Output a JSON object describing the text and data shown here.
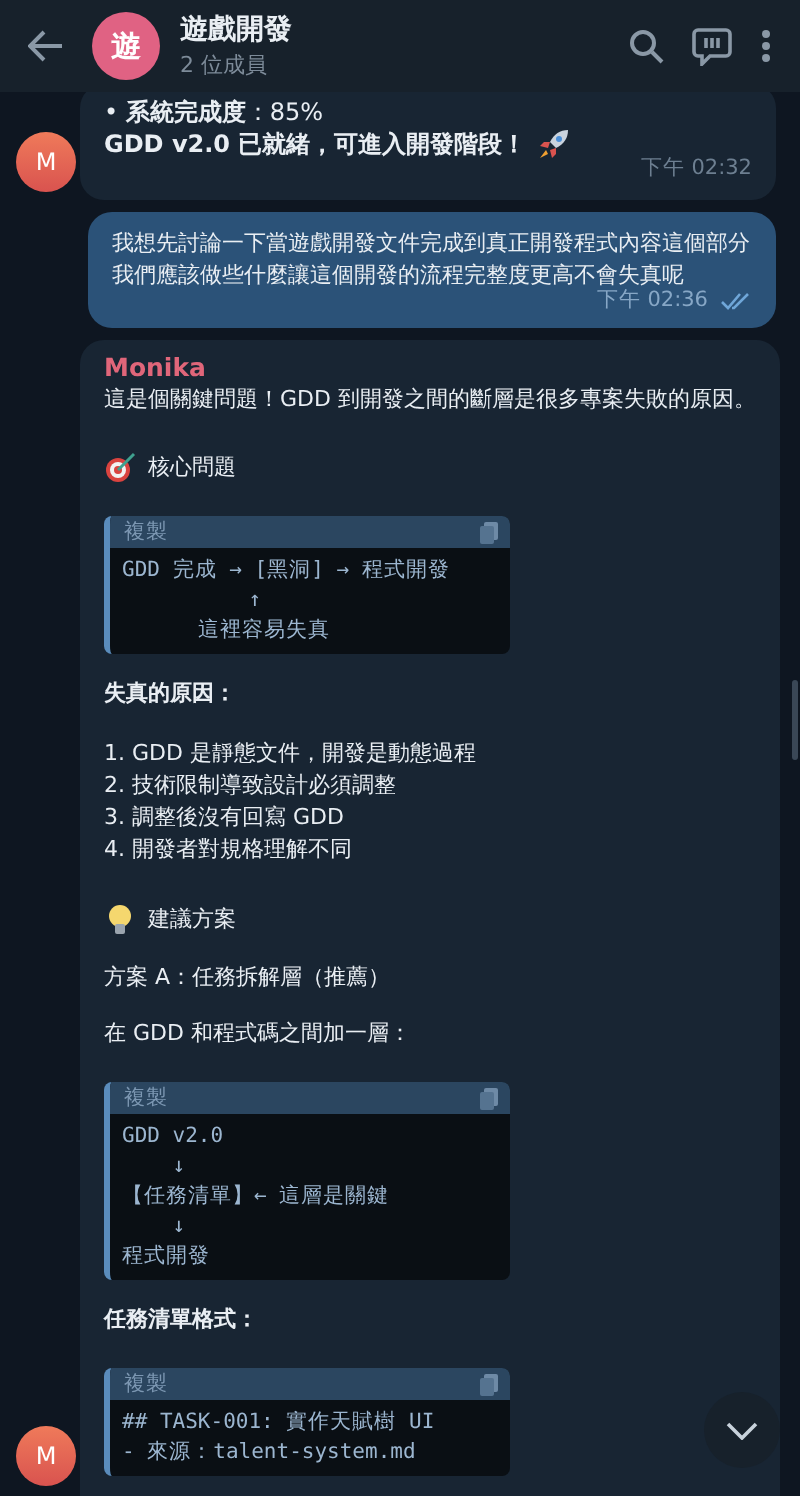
{
  "header": {
    "avatar_letter": "遊",
    "title": "遊戲開發",
    "subtitle": "2 位成員"
  },
  "messages": [
    {
      "kind": "incoming",
      "avatar": "M",
      "time": "下午 02:32",
      "blocks": [
        {
          "kind": "text",
          "text": "• **系統完成度**：85%"
        },
        {
          "kind": "rocket",
          "text": "GDD v2.0 已就緒，可進入開發階段！"
        }
      ]
    },
    {
      "kind": "outgoing",
      "time": "下午 02:36",
      "read": true,
      "blocks": [
        {
          "kind": "text",
          "text": "我想先討論一下當遊戲開發文件完成到真正開發程式內容這個部分"
        },
        {
          "kind": "text",
          "text": "我們應該做些什麼讓這個開發的流程完整度更高不會失真呢"
        }
      ]
    },
    {
      "kind": "incoming",
      "avatar": "M",
      "sender": "Monika",
      "blocks": [
        {
          "kind": "text",
          "text": "這是個關鍵問題！GDD 到開發之間的斷層是很多專案失敗的原因。"
        },
        {
          "kind": "target",
          "text": "核心問題"
        },
        {
          "kind": "code",
          "copy_label": "複製",
          "lines": [
            "GDD 完成 → [黑洞] → 程式開發",
            "          ↑",
            "      這裡容易失真"
          ]
        },
        {
          "kind": "bold",
          "text": "失真的原因："
        },
        {
          "kind": "list",
          "items": [
            "1. GDD 是靜態文件，開發是動態過程",
            "2. 技術限制導致設計必須調整",
            "3. 調整後沒有回寫 GDD",
            "4. 開發者對規格理解不同"
          ]
        },
        {
          "kind": "bulb",
          "text": "建議方案"
        },
        {
          "kind": "text",
          "text": "方案 A：任務拆解層（推薦）"
        },
        {
          "kind": "text",
          "text": "在 GDD 和程式碼之間加一層："
        },
        {
          "kind": "code",
          "copy_label": "複製",
          "lines": [
            "GDD v2.0",
            "    ↓",
            "【任務清單】← 這層是關鍵",
            "    ↓",
            "程式開發"
          ]
        },
        {
          "kind": "bold",
          "text": "任務清單格式："
        },
        {
          "kind": "code",
          "copy_label": "複製",
          "lines": [
            "## TASK-001: 實作天賦樹 UI",
            "- 來源：talent-system.md"
          ]
        }
      ]
    }
  ]
}
